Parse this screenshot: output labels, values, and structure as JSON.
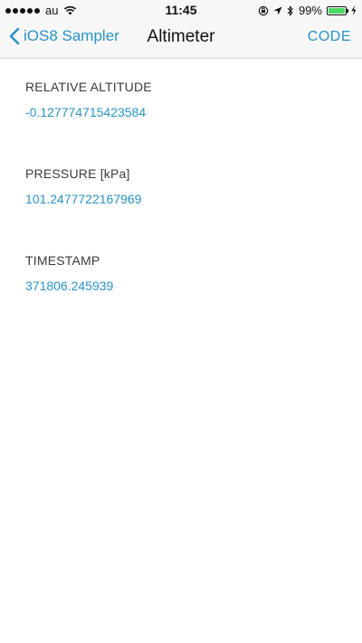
{
  "status_bar": {
    "carrier": "au",
    "time": "11:45",
    "battery_percent_text": "99%",
    "battery_level": 0.99,
    "battery_color": "#4cd964",
    "icons": [
      "signal-dots",
      "wifi-icon",
      "orientation-lock-icon",
      "location-icon",
      "bluetooth-icon",
      "battery-icon",
      "charging-icon"
    ]
  },
  "nav": {
    "back_label": "iOS8 Sampler",
    "title": "Altimeter",
    "action_label": "CODE",
    "tint_color": "#2a93c7"
  },
  "fields": [
    {
      "label": "RELATIVE ALTITUDE",
      "value": "-0.127774715423584"
    },
    {
      "label": "PRESSURE [kPa]",
      "value": "101.2477722167969"
    },
    {
      "label": "TIMESTAMP",
      "value": "371806.245939"
    }
  ]
}
